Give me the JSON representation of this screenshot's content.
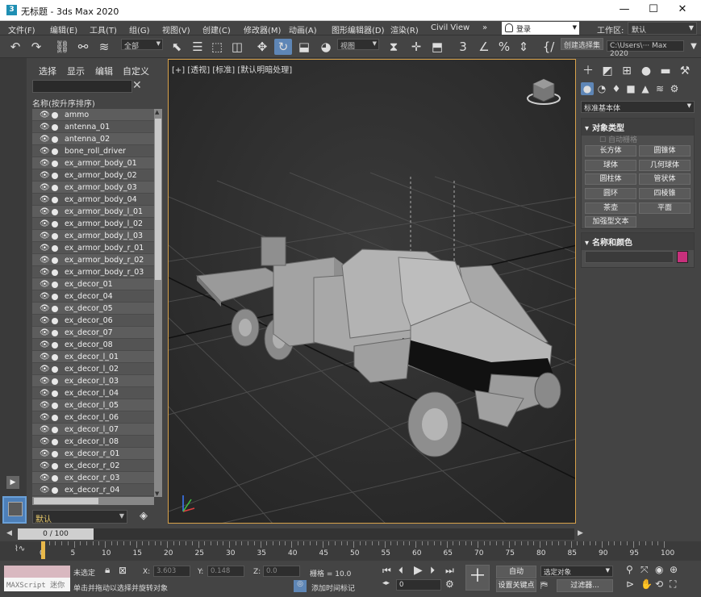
{
  "window": {
    "title": "无标题 - 3ds Max 2020",
    "logo": "3",
    "minimize": "—",
    "maximize": "☐",
    "close": "✕"
  },
  "menu": [
    "文件(F)",
    "编辑(E)",
    "工具(T)",
    "组(G)",
    "视图(V)",
    "创建(C)",
    "修改器(M)",
    "动画(A)",
    "图形编辑器(D)",
    "渲染(R)",
    "Civil View",
    "»"
  ],
  "login": {
    "label": "登录"
  },
  "workspace": {
    "label": "工作区:",
    "value": "默认"
  },
  "toolbar": {
    "filter_value": "全部",
    "view_value": "视图",
    "named_sel": "创建选择集",
    "path": "C:\\Users\\··· Max 2020"
  },
  "scene_explorer": {
    "tabs": [
      "选择",
      "显示",
      "编辑",
      "自定义"
    ],
    "column_header": "名称(按升序排序)",
    "items": [
      "ammo",
      "antenna_01",
      "antenna_02",
      "bone_roll_driver",
      "ex_armor_body_01",
      "ex_armor_body_02",
      "ex_armor_body_03",
      "ex_armor_body_04",
      "ex_armor_body_l_01",
      "ex_armor_body_l_02",
      "ex_armor_body_l_03",
      "ex_armor_body_r_01",
      "ex_armor_body_r_02",
      "ex_armor_body_r_03",
      "ex_decor_01",
      "ex_decor_04",
      "ex_decor_05",
      "ex_decor_06",
      "ex_decor_07",
      "ex_decor_08",
      "ex_decor_l_01",
      "ex_decor_l_02",
      "ex_decor_l_03",
      "ex_decor_l_04",
      "ex_decor_l_05",
      "ex_decor_l_06",
      "ex_decor_l_07",
      "ex_decor_l_08",
      "ex_decor_r_01",
      "ex_decor_r_02",
      "ex_decor_r_03",
      "ex_decor_r_04"
    ],
    "layer": "默认"
  },
  "viewport": {
    "label": "[+] [透视] [标准] [默认明暗处理]"
  },
  "command_panel": {
    "type_dropdown": "标准基本体",
    "object_type": {
      "header": "对象类型",
      "autogrid": "自动栅格",
      "buttons": [
        "长方体",
        "圆锥体",
        "球体",
        "几何球体",
        "圆柱体",
        "管状体",
        "圆环",
        "四棱锥",
        "茶壶",
        "平面",
        "加强型文本"
      ]
    },
    "name_color": {
      "header": "名称和颜色",
      "color": "#c8307c"
    }
  },
  "timeline": {
    "frame_display": "0 / 100",
    "ticks": [
      "0",
      "5",
      "10",
      "15",
      "20",
      "25",
      "30",
      "35",
      "40",
      "45",
      "50",
      "55",
      "60",
      "65",
      "70",
      "75",
      "80",
      "85",
      "90",
      "95",
      "100"
    ]
  },
  "status": {
    "maxscript": "MAXScript 迷你",
    "selection": "未选定",
    "prompt": "单击并拖动以选择并旋转对象",
    "x_value": "3.603",
    "y_value": "0.148",
    "z_value": "0.0",
    "grid": "栅格 = 10.0",
    "add_time_tag": "添加时间标记",
    "auto": "自动",
    "selected_object": "选定对象",
    "set_key": "设置关键点",
    "filter": "过滤器...",
    "frame_field": "0"
  }
}
